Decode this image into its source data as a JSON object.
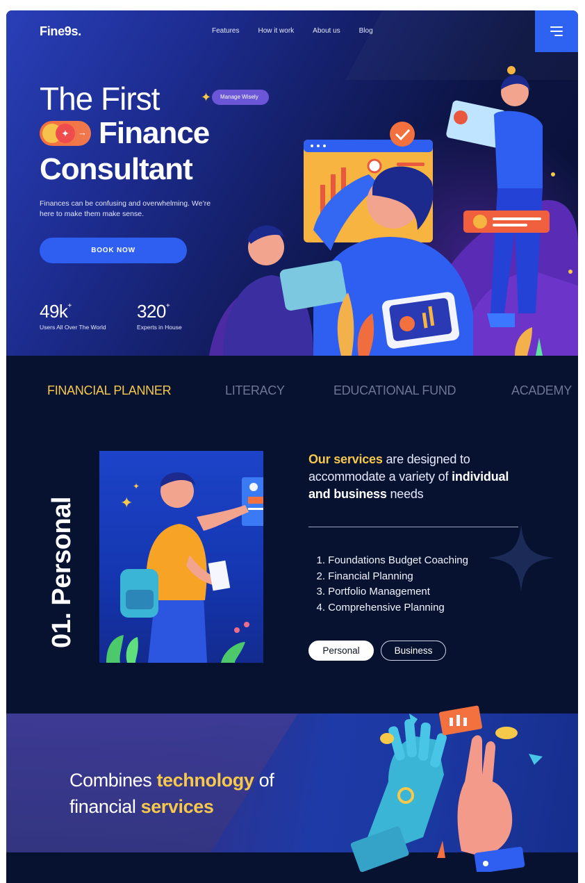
{
  "brand": {
    "logo": "Fine9s.",
    "accent": "#2f5ff1",
    "highlight": "#f6c84c",
    "background": "#071231"
  },
  "nav": {
    "items": [
      "Features",
      "How it work",
      "About us",
      "Blog"
    ],
    "menu_icon": "hamburger-menu-icon"
  },
  "hero": {
    "title_line1": "The First",
    "badge": "Manage Wisely",
    "title_line2": "Finance",
    "title_line3": "Consultant",
    "subtitle": "Finances can be confusing and overwhelming. We’re here to make them make sense.",
    "cta": "BOOK NOW",
    "stats": [
      {
        "value": "49k",
        "suffix": "+",
        "label": "Users All Over The World"
      },
      {
        "value": "320",
        "suffix": "+",
        "label": "Experts in House"
      }
    ]
  },
  "tabs": [
    {
      "label": "FINANCIAL PLANNER",
      "active": true
    },
    {
      "label": "LITERACY",
      "active": false
    },
    {
      "label": "EDUCATIONAL FUND",
      "active": false
    },
    {
      "label": "ACADEMY",
      "active": false
    }
  ],
  "services": {
    "vertical_title": "01. Personal",
    "heading_highlight": "Our services",
    "heading_rest1": " are designed to accommodate a variety of ",
    "heading_bold": "individual and  business",
    "heading_rest2": " needs",
    "list": [
      {
        "n": "1.",
        "label": "Foundations Budget Coaching"
      },
      {
        "n": "2.",
        "label": "Financial Planning"
      },
      {
        "n": "3.",
        "label": "Portfolio Management"
      },
      {
        "n": "4.",
        "label": "Comprehensive Planning"
      }
    ],
    "pills": [
      "Personal",
      "Business"
    ]
  },
  "banner": {
    "part1": "Combines ",
    "part2": "technology",
    "part3": " of",
    "part4": "financial ",
    "part5": "services"
  }
}
